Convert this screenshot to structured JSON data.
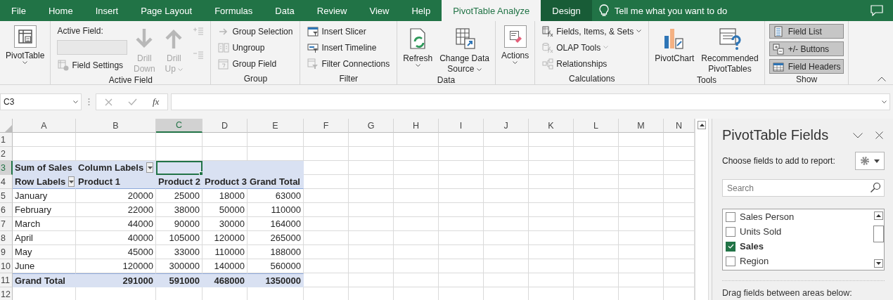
{
  "tabs": [
    {
      "label": "File",
      "selected": false,
      "kind": "standard"
    },
    {
      "label": "Home",
      "selected": false,
      "kind": "standard"
    },
    {
      "label": "Insert",
      "selected": false,
      "kind": "standard"
    },
    {
      "label": "Page Layout",
      "selected": false,
      "kind": "standard"
    },
    {
      "label": "Formulas",
      "selected": false,
      "kind": "standard"
    },
    {
      "label": "Data",
      "selected": false,
      "kind": "standard"
    },
    {
      "label": "Review",
      "selected": false,
      "kind": "standard"
    },
    {
      "label": "View",
      "selected": false,
      "kind": "standard"
    },
    {
      "label": "Help",
      "selected": false,
      "kind": "standard"
    },
    {
      "label": "PivotTable Analyze",
      "selected": true,
      "kind": "contextual"
    },
    {
      "label": "Design",
      "selected": false,
      "kind": "contextual"
    }
  ],
  "tell_me": "Tell me what you want to do",
  "ribbon": {
    "groups": [
      {
        "columns": [
          {
            "items": [
              {
                "kind": "large",
                "label": "PivotTable",
                "disabled": false,
                "caret": true,
                "framed": true
              }
            ]
          }
        ]
      },
      {
        "label": "Active Field",
        "columns": [
          {
            "items": [
              {
                "kind": "heading",
                "label": "Active Field:"
              },
              {
                "kind": "field",
                "disabled": true
              },
              {
                "kind": "small",
                "label": "Field Settings",
                "disabled": true,
                "caret": false
              }
            ]
          },
          {
            "items": [
              {
                "kind": "large",
                "label": "Drill\nDown",
                "disabled": true,
                "caret": false,
                "framed": false
              }
            ]
          },
          {
            "items": [
              {
                "kind": "large",
                "label": "Drill\nUp",
                "disabled": true,
                "caret": true,
                "framed": false
              }
            ]
          },
          {
            "items": [
              {
                "kind": "mini",
                "disabled": true
              },
              {
                "kind": "mini",
                "disabled": true
              }
            ]
          }
        ]
      },
      {
        "label": "Group",
        "columns": [
          {
            "items": [
              {
                "kind": "small",
                "label": "Group Selection",
                "disabled": true,
                "caret": false
              },
              {
                "kind": "small",
                "label": "Ungroup",
                "disabled": true,
                "caret": false
              },
              {
                "kind": "small",
                "label": "Group Field",
                "disabled": true,
                "caret": false
              }
            ]
          }
        ]
      },
      {
        "label": "Filter",
        "columns": [
          {
            "items": [
              {
                "kind": "small",
                "label": "Insert Slicer",
                "disabled": false,
                "caret": false
              },
              {
                "kind": "small",
                "label": "Insert Timeline",
                "disabled": false,
                "caret": false
              },
              {
                "kind": "small",
                "label": "Filter Connections",
                "disabled": true,
                "caret": false
              }
            ]
          }
        ]
      },
      {
        "label": "Data",
        "columns": [
          {
            "items": [
              {
                "kind": "large",
                "label": "Refresh",
                "disabled": false,
                "caret": true,
                "framed": false
              }
            ]
          },
          {
            "items": [
              {
                "kind": "large",
                "label": "Change Data\nSource",
                "disabled": false,
                "caret": true,
                "framed": false
              }
            ]
          }
        ]
      },
      {
        "columns": [
          {
            "items": [
              {
                "kind": "large",
                "label": "Actions",
                "disabled": false,
                "caret": true,
                "framed": true
              }
            ]
          }
        ]
      },
      {
        "label": "Calculations",
        "columns": [
          {
            "items": [
              {
                "kind": "small",
                "label": "Fields, Items, & Sets",
                "disabled": false,
                "caret": true
              },
              {
                "kind": "small",
                "label": "OLAP Tools",
                "disabled": true,
                "caret": true
              },
              {
                "kind": "small",
                "label": "Relationships",
                "disabled": true,
                "caret": false
              }
            ]
          }
        ]
      },
      {
        "label": "Tools",
        "columns": [
          {
            "items": [
              {
                "kind": "large",
                "label": "PivotChart",
                "disabled": false,
                "caret": false,
                "framed": false
              }
            ]
          },
          {
            "items": [
              {
                "kind": "large",
                "label": "Recommended\nPivotTables",
                "disabled": false,
                "caret": false,
                "framed": false
              }
            ]
          }
        ]
      },
      {
        "label": "Show",
        "columns": [
          {
            "items": [
              {
                "kind": "toggle",
                "label": "Field List",
                "on": true
              },
              {
                "kind": "toggle",
                "label": "+/- Buttons",
                "on": true
              },
              {
                "kind": "toggle",
                "label": "Field Headers",
                "on": true
              }
            ]
          }
        ]
      }
    ]
  },
  "formula_bar": {
    "name_box": "C3",
    "function_label": "fx"
  },
  "sheet": {
    "columns": [
      {
        "label": "A",
        "selected": false
      },
      {
        "label": "B",
        "selected": false
      },
      {
        "label": "C",
        "selected": true
      },
      {
        "label": "D",
        "selected": false
      },
      {
        "label": "E",
        "selected": false
      },
      {
        "label": "F",
        "selected": false
      },
      {
        "label": "G",
        "selected": false
      },
      {
        "label": "H",
        "selected": false
      },
      {
        "label": "I",
        "selected": false
      },
      {
        "label": "J",
        "selected": false
      },
      {
        "label": "K",
        "selected": false
      },
      {
        "label": "L",
        "selected": false
      },
      {
        "label": "M",
        "selected": false
      },
      {
        "label": "N",
        "selected": false
      }
    ],
    "rows": [
      {
        "number": "1",
        "selected": false,
        "kind": "blank"
      },
      {
        "number": "2",
        "selected": false,
        "kind": "blank"
      },
      {
        "number": "3",
        "selected": true,
        "kind": "pivot-header",
        "cells": [
          {
            "text": "Sum of Sales",
            "filter": false
          },
          {
            "text": "Column Labels",
            "filter": true
          }
        ]
      },
      {
        "number": "4",
        "selected": false,
        "kind": "pivot-columns",
        "cells": [
          {
            "text": "Row Labels",
            "filter": true
          },
          {
            "text": "Product 1",
            "filter": false
          },
          {
            "text": "Product 2",
            "filter": false
          },
          {
            "text": "Product 3",
            "filter": false
          },
          {
            "text": "Grand Total",
            "filter": false
          }
        ]
      },
      {
        "number": "5",
        "selected": false,
        "kind": "pivot-data",
        "cells": [
          "January",
          "20000",
          "25000",
          "18000",
          "63000"
        ]
      },
      {
        "number": "6",
        "selected": false,
        "kind": "pivot-data",
        "cells": [
          "February",
          "22000",
          "38000",
          "50000",
          "110000"
        ]
      },
      {
        "number": "7",
        "selected": false,
        "kind": "pivot-data",
        "cells": [
          "March",
          "44000",
          "90000",
          "30000",
          "164000"
        ]
      },
      {
        "number": "8",
        "selected": false,
        "kind": "pivot-data",
        "cells": [
          "April",
          "40000",
          "105000",
          "120000",
          "265000"
        ]
      },
      {
        "number": "9",
        "selected": false,
        "kind": "pivot-data",
        "cells": [
          "May",
          "45000",
          "33000",
          "110000",
          "188000"
        ]
      },
      {
        "number": "10",
        "selected": false,
        "kind": "pivot-data",
        "cells": [
          "June",
          "120000",
          "300000",
          "140000",
          "560000"
        ]
      },
      {
        "number": "11",
        "selected": false,
        "kind": "pivot-total",
        "cells": [
          "Grand Total",
          "291000",
          "591000",
          "468000",
          "1350000"
        ]
      },
      {
        "number": "12",
        "selected": false,
        "kind": "blank"
      }
    ]
  },
  "pane": {
    "title": "PivotTable Fields",
    "subtitle": "Choose fields to add to report:",
    "search": {
      "placeholder": "Search"
    },
    "fields": [
      {
        "label": "Sales Person",
        "checked": false
      },
      {
        "label": "Units Sold",
        "checked": false
      },
      {
        "label": "Sales",
        "checked": true
      },
      {
        "label": "Region",
        "checked": false
      }
    ],
    "areas_hint": "Drag fields between areas below:"
  }
}
